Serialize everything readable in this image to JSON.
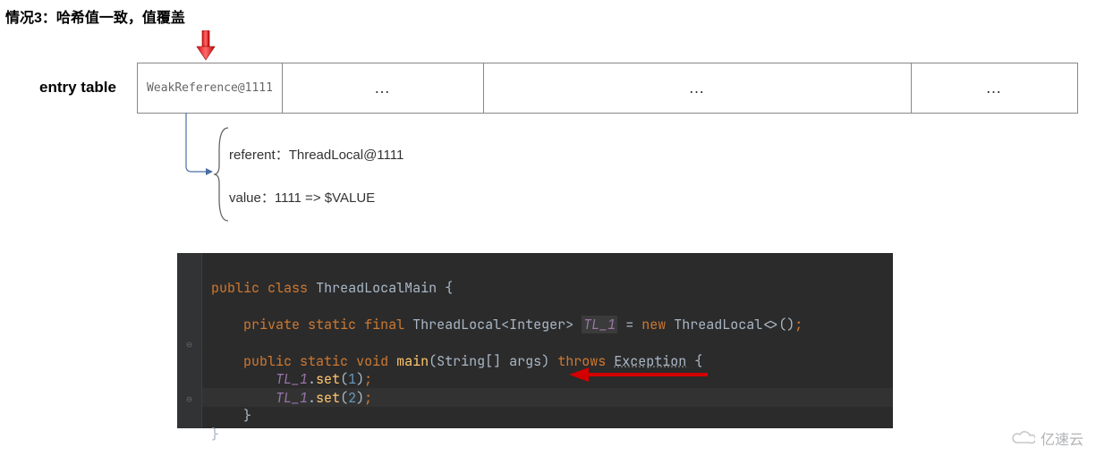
{
  "title": "情况3：哈希值一致，值覆盖",
  "entry_table": {
    "label": "entry table",
    "cells": [
      "WeakReference@1111",
      "…",
      "…",
      "…"
    ]
  },
  "detail": {
    "referent": "referent：ThreadLocal@1111",
    "value": "value：1111  => $VALUE"
  },
  "code": {
    "tokens": {
      "public": "public",
      "class": "class",
      "classname": "ThreadLocalMain",
      "private": "private",
      "static": "static",
      "final": "final",
      "tl_type": "ThreadLocal",
      "generic": "Integer",
      "field": "TL_1",
      "eq": "=",
      "new": "new",
      "diamond": "<>()",
      "void": "void",
      "main": "main",
      "stringarr": "String[]",
      "args": "args",
      "throws": "throws",
      "exc": "Exception",
      "set": "set",
      "n1": "1",
      "n2": "2",
      "semi": ";",
      "ob": "{",
      "cb": "}"
    }
  },
  "watermark": "亿速云"
}
